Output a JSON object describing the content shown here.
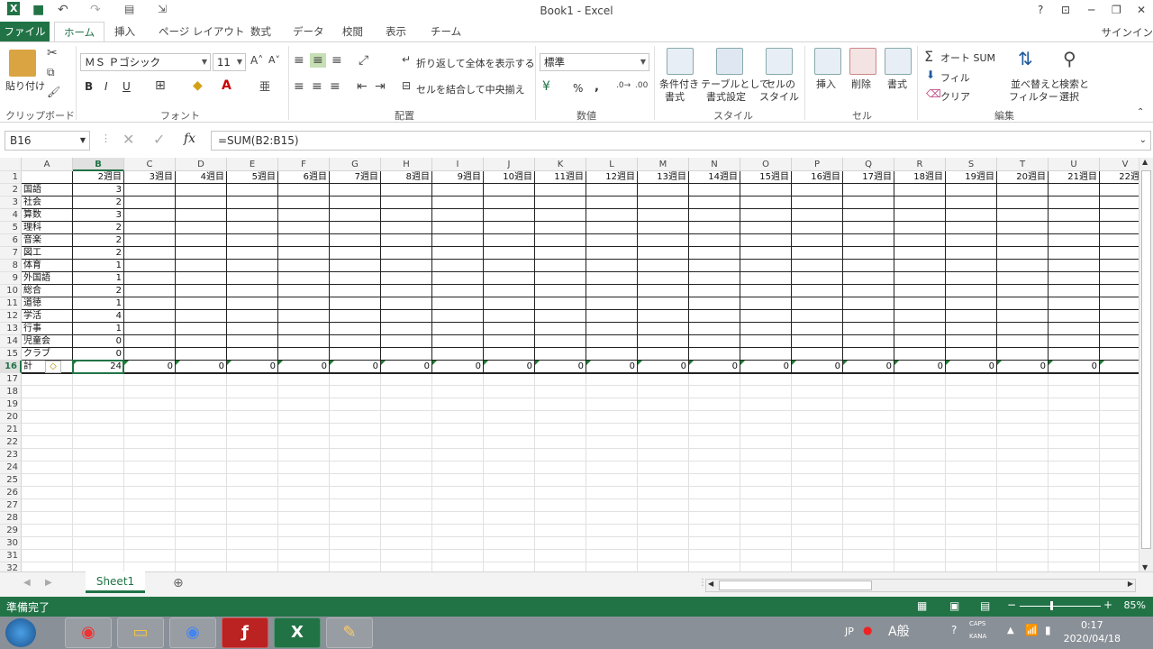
{
  "window": {
    "title": "Book1 - Excel",
    "help": "?",
    "minimize": "─",
    "restore": "❐",
    "close": "✕"
  },
  "tabs": [
    "ファイル",
    "ホーム",
    "挿入",
    "ページ レイアウト",
    "数式",
    "データ",
    "校閲",
    "表示",
    "チーム"
  ],
  "signin": "サインイン",
  "ribbon": {
    "clipboard": {
      "paste": "貼り付け",
      "label": "クリップボード"
    },
    "font": {
      "name": "ＭＳ Ｐゴシック",
      "size": "11",
      "bold": "B",
      "italic": "I",
      "underline": "U",
      "label": "フォント"
    },
    "align": {
      "wrap": "折り返して全体を表示する",
      "merge": "セルを結合して中央揃え",
      "label": "配置"
    },
    "number": {
      "format": "標準",
      "percent": "%",
      "comma": ",",
      "label": "数値"
    },
    "styles": {
      "cond": [
        "条件付き",
        "書式"
      ],
      "table": [
        "テーブルとして",
        "書式設定"
      ],
      "cell": [
        "セルの",
        "スタイル"
      ],
      "label": "スタイル"
    },
    "cells": {
      "insert": "挿入",
      "delete": "削除",
      "format": "書式",
      "label": "セル"
    },
    "edit": {
      "autosum": "オート SUM",
      "fill": "フィル",
      "clear": "クリア",
      "sort": [
        "並べ替えと",
        "フィルター"
      ],
      "find": [
        "検索と",
        "選択"
      ],
      "label": "編集"
    }
  },
  "formula_bar": {
    "name_box": "B16",
    "formula": "=SUM(B2:B15)",
    "fx": "fx"
  },
  "columns": [
    "A",
    "B",
    "C",
    "D",
    "E",
    "F",
    "G",
    "H",
    "I",
    "J",
    "K",
    "L",
    "M",
    "N",
    "O",
    "P",
    "Q",
    "R",
    "S",
    "T",
    "U",
    "V"
  ],
  "week_headers": [
    "2週目",
    "3週目",
    "4週目",
    "5週目",
    "6週目",
    "7週目",
    "8週目",
    "9週目",
    "10週目",
    "11週目",
    "12週目",
    "13週目",
    "14週目",
    "15週目",
    "16週目",
    "17週目",
    "18週目",
    "19週目",
    "20週目",
    "21週目",
    "22週目"
  ],
  "subjects": [
    {
      "name": "国語",
      "b": "3"
    },
    {
      "name": "社会",
      "b": "2"
    },
    {
      "name": "算数",
      "b": "3"
    },
    {
      "name": "理科",
      "b": "2"
    },
    {
      "name": "音楽",
      "b": "2"
    },
    {
      "name": "図工",
      "b": "2"
    },
    {
      "name": "体育",
      "b": "1"
    },
    {
      "name": "外国語",
      "b": "1"
    },
    {
      "name": "総合",
      "b": "2"
    },
    {
      "name": "道徳",
      "b": "1"
    },
    {
      "name": "学活",
      "b": "4"
    },
    {
      "name": "行事",
      "b": "1"
    },
    {
      "name": "児童会",
      "b": "0"
    },
    {
      "name": "クラブ",
      "b": "0"
    }
  ],
  "total": {
    "label": "計",
    "b": "24",
    "others": "0"
  },
  "row_numbers": [
    "1",
    "2",
    "3",
    "4",
    "5",
    "6",
    "7",
    "8",
    "9",
    "10",
    "11",
    "12",
    "13",
    "14",
    "15",
    "16",
    "17",
    "18",
    "19",
    "20",
    "21",
    "22",
    "23",
    "24",
    "25",
    "26",
    "27",
    "28",
    "29",
    "30",
    "31",
    "32"
  ],
  "sheet_tab": "Sheet1",
  "status": "準備完了",
  "zoom": "85%",
  "clock": {
    "time": "0:17",
    "date": "2020/04/18"
  },
  "tray": {
    "lang": "JP",
    "caps": "CAPS",
    "kana": "KANA"
  },
  "colors": {
    "excel_green": "#217346"
  }
}
